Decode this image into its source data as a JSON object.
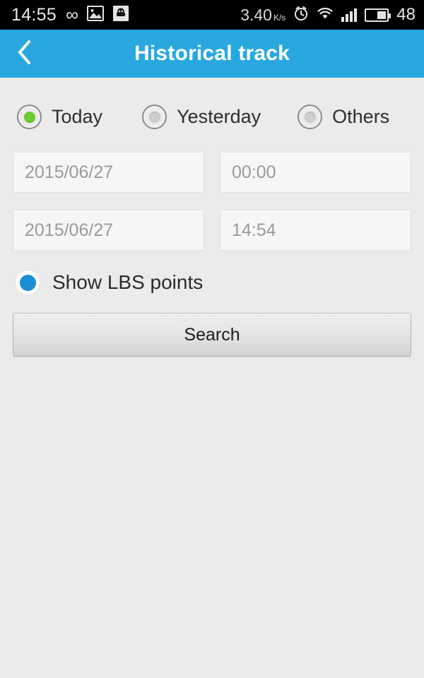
{
  "status_bar": {
    "clock": "14:55",
    "infinity_icon": "infinity-icon",
    "gallery_icon": "gallery-icon",
    "qq_icon": "qq-icon",
    "network_speed": "3.40",
    "network_speed_unit": "K/s",
    "alarm_icon": "alarm-clock-icon",
    "wifi_icon": "wifi-icon",
    "signal_icon": "signal-bars-icon",
    "battery_icon": "battery-icon",
    "battery_level": "48"
  },
  "header": {
    "back_icon": "chevron-left-icon",
    "title": "Historical track",
    "background_color": "#29a8e0"
  },
  "range_options": {
    "items": [
      {
        "label": "Today",
        "selected": true
      },
      {
        "label": "Yesterday",
        "selected": false
      },
      {
        "label": "Others",
        "selected": false
      }
    ],
    "selected_color": "#6dcb2f"
  },
  "fields": {
    "start_date": {
      "value": "2015/06/27",
      "placeholder": "2015/06/27"
    },
    "start_time": {
      "value": "00:00",
      "placeholder": "00:00"
    },
    "end_date": {
      "value": "2015/06/27",
      "placeholder": "2015/06/27"
    },
    "end_time": {
      "value": "14:54",
      "placeholder": "14:54"
    }
  },
  "lbs": {
    "label": "Show LBS points",
    "checked": true,
    "color": "#1b8ed6"
  },
  "actions": {
    "search_label": "Search"
  }
}
